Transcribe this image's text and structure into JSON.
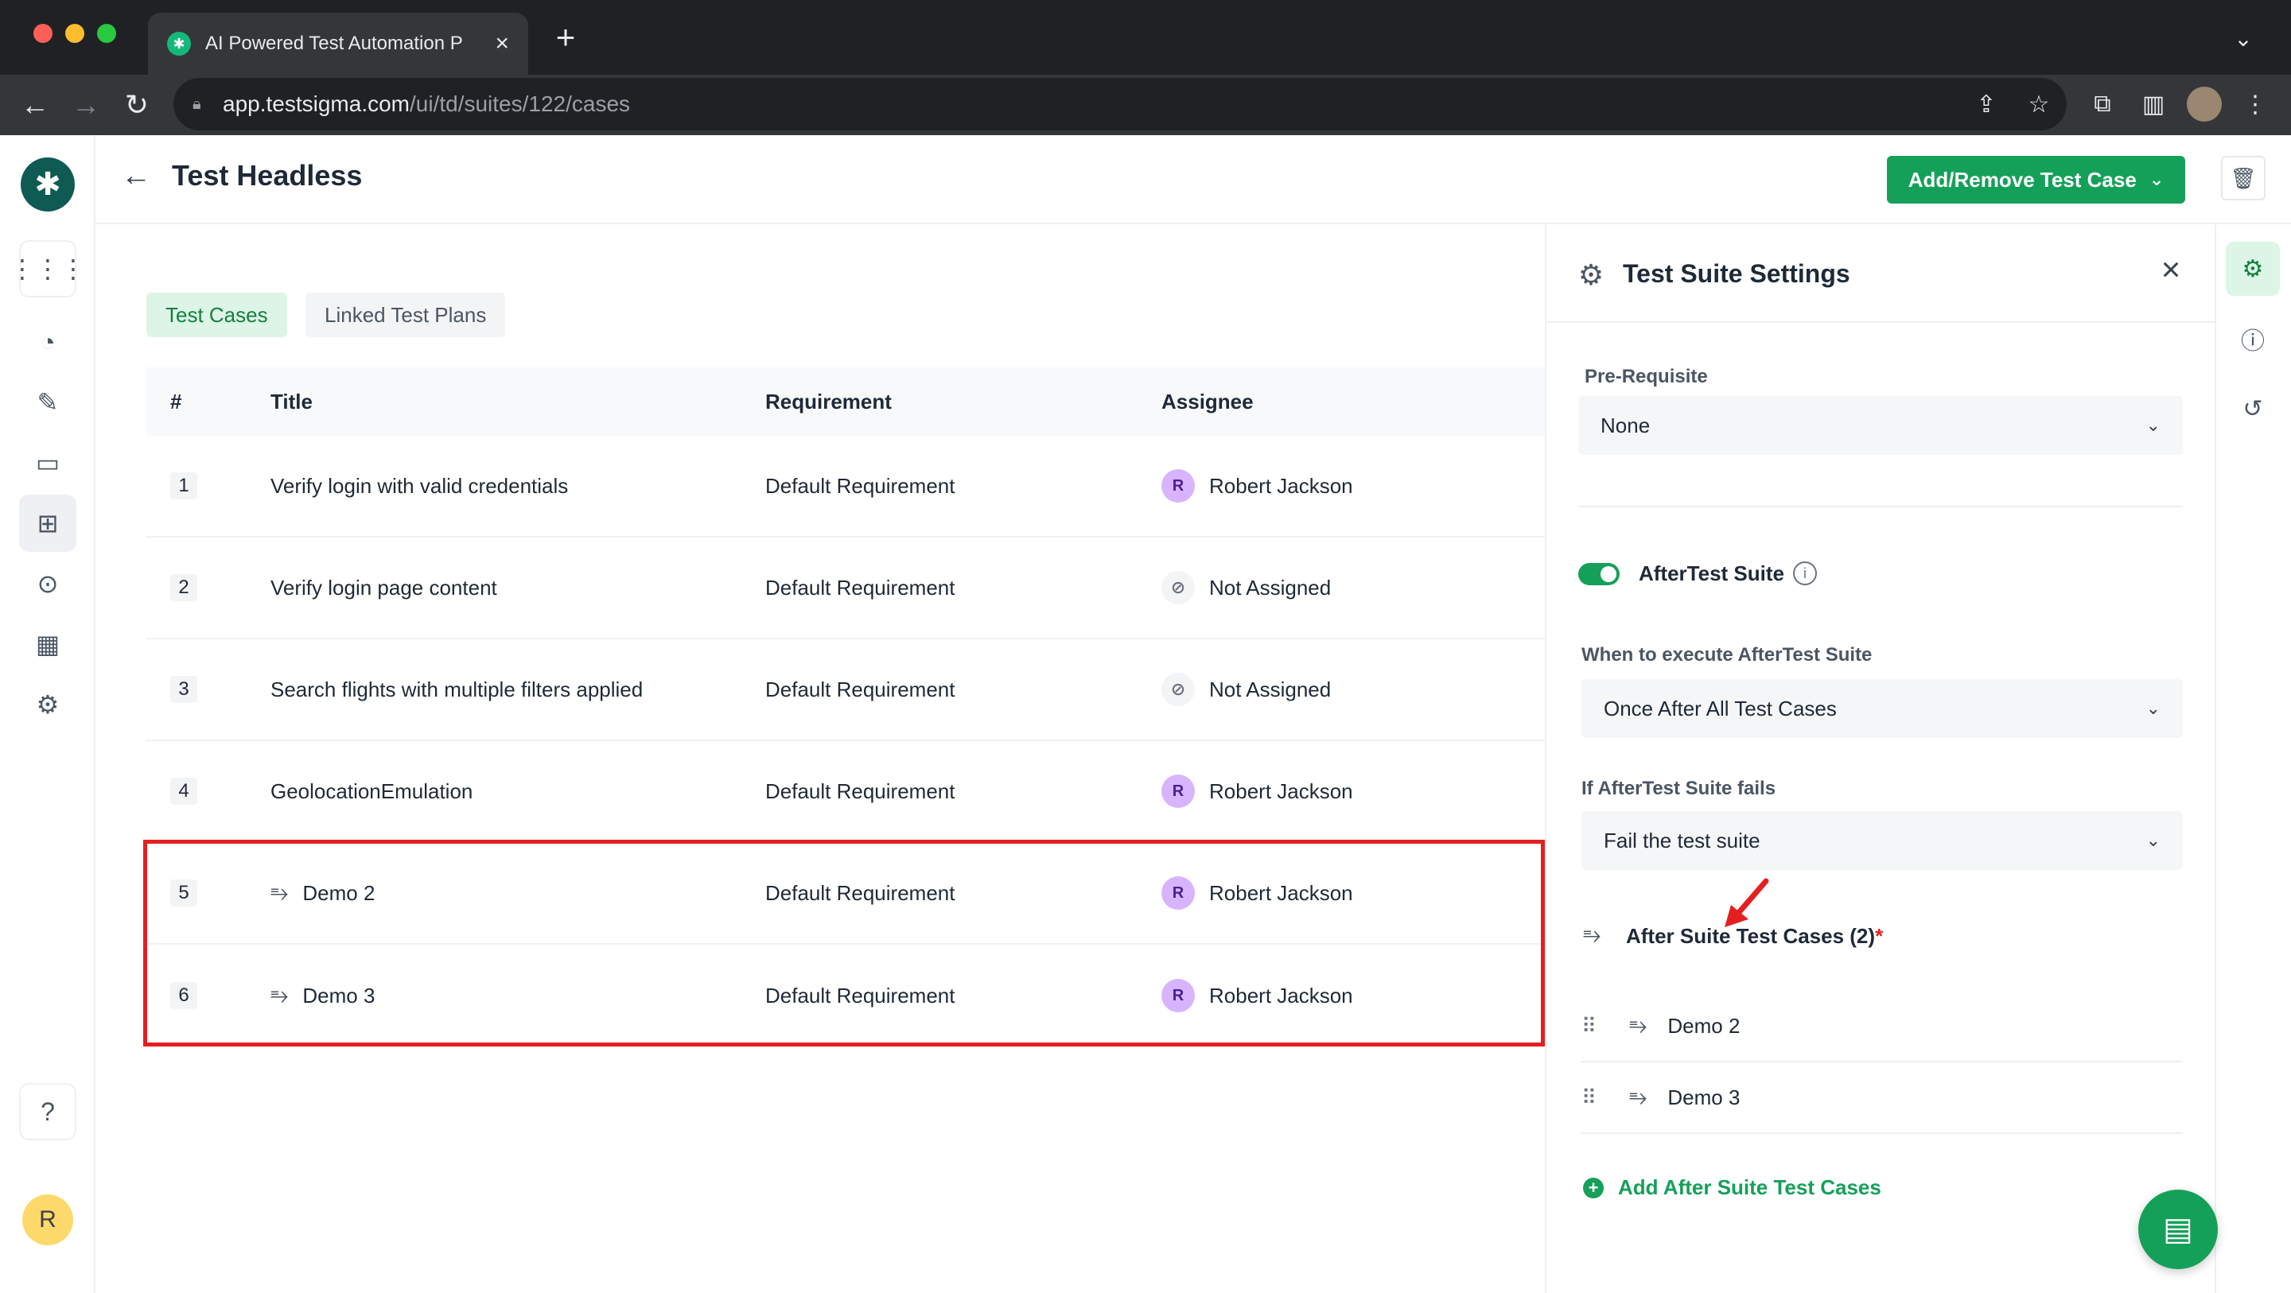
{
  "browser": {
    "tab_title": "AI Powered Test Automation P",
    "url_host": "app.testsigma.com",
    "url_path": "/ui/td/suites/122/cases"
  },
  "header": {
    "title": "Test Headless",
    "add_remove_label": "Add/Remove Test Case"
  },
  "tabs": [
    {
      "label": "Test Cases",
      "active": true
    },
    {
      "label": "Linked Test Plans",
      "active": false
    }
  ],
  "table": {
    "columns": [
      "#",
      "Title",
      "Requirement",
      "Assignee"
    ],
    "rows": [
      {
        "num": "1",
        "title": "Verify login with valid credentials",
        "requirement": "Default Requirement",
        "assignee": "Robert Jackson",
        "initial": "R",
        "has_list_icon": false
      },
      {
        "num": "2",
        "title": "Verify login page content",
        "requirement": "Default Requirement",
        "assignee": "Not Assigned",
        "initial": "",
        "has_list_icon": false
      },
      {
        "num": "3",
        "title": "Search flights with multiple filters applied",
        "requirement": "Default Requirement",
        "assignee": "Not Assigned",
        "initial": "",
        "has_list_icon": false
      },
      {
        "num": "4",
        "title": "GeolocationEmulation",
        "requirement": "Default Requirement",
        "assignee": "Robert Jackson",
        "initial": "R",
        "has_list_icon": false
      },
      {
        "num": "5",
        "title": "Demo 2",
        "requirement": "Default Requirement",
        "assignee": "Robert Jackson",
        "initial": "R",
        "has_list_icon": true
      },
      {
        "num": "6",
        "title": "Demo 3",
        "requirement": "Default Requirement",
        "assignee": "Robert Jackson",
        "initial": "R",
        "has_list_icon": true
      }
    ]
  },
  "settings": {
    "title": "Test Suite Settings",
    "prerequisite_label": "Pre-Requisite",
    "prerequisite_value": "None",
    "aftertest_label": "AfterTest Suite",
    "aftertest_enabled": true,
    "when_label": "When to execute AfterTest Suite",
    "when_value": "Once After All Test Cases",
    "fails_label": "If AfterTest Suite fails",
    "fails_value": "Fail the test suite",
    "after_cases_label": "After Suite Test Cases (2)",
    "required_mark": "*",
    "after_cases": [
      "Demo 2",
      "Demo 3"
    ],
    "add_after_label": "Add After Suite Test Cases"
  },
  "user": {
    "initial": "R"
  },
  "colors": {
    "accent": "#15a05a",
    "highlight": "#e51f1f"
  }
}
